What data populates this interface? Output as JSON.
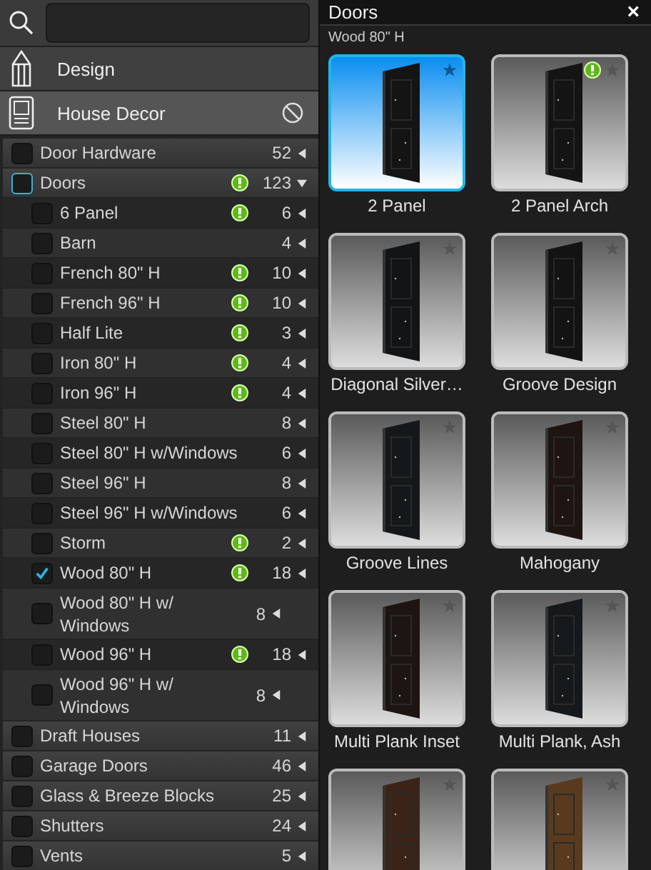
{
  "nav": [
    {
      "label": "Design",
      "kind": "pencil",
      "selected": false,
      "blocked": false
    },
    {
      "label": "House Decor",
      "kind": "panel",
      "selected": true,
      "blocked": true
    }
  ],
  "categories": [
    {
      "label": "Door Hardware",
      "count": "52",
      "checked": false,
      "focused": false,
      "warning": false,
      "expanded": false
    },
    {
      "label": "Doors",
      "count": "123",
      "checked": false,
      "focused": true,
      "warning": true,
      "expanded": true,
      "children": [
        {
          "label": "6 Panel",
          "count": "6",
          "checked": false,
          "warning": true
        },
        {
          "label": "Barn",
          "count": "4",
          "checked": false,
          "warning": false
        },
        {
          "label": "French 80\" H",
          "count": "10",
          "checked": false,
          "warning": true
        },
        {
          "label": "French 96\" H",
          "count": "10",
          "checked": false,
          "warning": true
        },
        {
          "label": "Half Lite",
          "count": "3",
          "checked": false,
          "warning": true
        },
        {
          "label": "Iron 80\" H",
          "count": "4",
          "checked": false,
          "warning": true
        },
        {
          "label": "Iron 96\" H",
          "count": "4",
          "checked": false,
          "warning": true
        },
        {
          "label": "Steel 80\" H",
          "count": "8",
          "checked": false,
          "warning": false
        },
        {
          "label": "Steel 80\" H w/Windows",
          "count": "6",
          "checked": false,
          "warning": false
        },
        {
          "label": "Steel 96\" H",
          "count": "8",
          "checked": false,
          "warning": false
        },
        {
          "label": "Steel 96\" H w/Windows",
          "count": "6",
          "checked": false,
          "warning": false
        },
        {
          "label": "Storm",
          "count": "2",
          "checked": false,
          "warning": true
        },
        {
          "label": "Wood 80\" H",
          "count": "18",
          "checked": true,
          "warning": true
        },
        {
          "label": "Wood 80\" H w/ Windows",
          "count": "8",
          "checked": false,
          "warning": false
        },
        {
          "label": "Wood 96\" H",
          "count": "18",
          "checked": false,
          "warning": true
        },
        {
          "label": "Wood 96\" H w/ Windows",
          "count": "8",
          "checked": false,
          "warning": false
        }
      ]
    },
    {
      "label": "Draft Houses",
      "count": "11",
      "checked": false,
      "focused": false,
      "warning": false,
      "expanded": false
    },
    {
      "label": "Garage Doors",
      "count": "46",
      "checked": false,
      "focused": false,
      "warning": false,
      "expanded": false
    },
    {
      "label": "Glass & Breeze Blocks",
      "count": "25",
      "checked": false,
      "focused": false,
      "warning": false,
      "expanded": false
    },
    {
      "label": "Shutters",
      "count": "24",
      "checked": false,
      "focused": false,
      "warning": false,
      "expanded": false
    },
    {
      "label": "Vents",
      "count": "5",
      "checked": false,
      "focused": false,
      "warning": false,
      "expanded": false
    }
  ],
  "panel": {
    "title": "Doors",
    "close": "×",
    "subtitle": "Wood 80\" H"
  },
  "tiles": [
    {
      "name": "2 Panel",
      "selected": true,
      "warning": false
    },
    {
      "name": "2 Panel Arch",
      "selected": false,
      "warning": true
    },
    {
      "name": "Diagonal Silver…",
      "selected": false,
      "warning": false
    },
    {
      "name": "Groove Design",
      "selected": false,
      "warning": false
    },
    {
      "name": "Groove Lines",
      "selected": false,
      "warning": false
    },
    {
      "name": "Mahogany",
      "selected": false,
      "warning": false
    },
    {
      "name": "Multi Plank Inset",
      "selected": false,
      "warning": false
    },
    {
      "name": "Multi Plank, Ash",
      "selected": false,
      "warning": false
    },
    {
      "selected": false,
      "warning": false
    },
    {
      "selected": false,
      "warning": false
    }
  ]
}
